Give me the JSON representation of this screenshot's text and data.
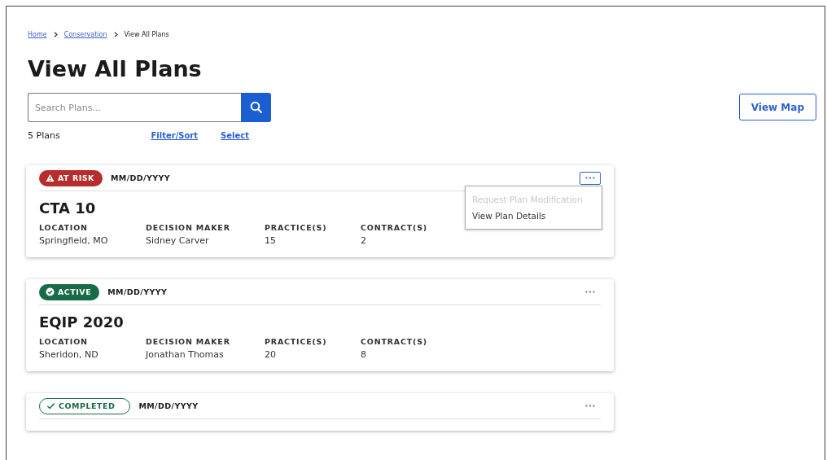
{
  "breadcrumb": [
    {
      "label": "Home",
      "kind": "link"
    },
    {
      "label": "Conservation",
      "kind": "link"
    },
    {
      "label": "View All Plans",
      "kind": "current"
    }
  ],
  "title": "View All Plans",
  "search": {
    "placeholder": "Search Plans..."
  },
  "view_map_button": "View Map",
  "count": "5 Plans",
  "actions": [
    "Filter/Sort",
    "Select"
  ],
  "plans": [
    {
      "status": {
        "kind": "at_risk",
        "label": "AT RISK"
      },
      "date": "MM/DD/YYYY",
      "name": "CTA 10",
      "menu_open": true,
      "menu": [
        {
          "label": "Request Plan Modification",
          "disabled": true
        },
        {
          "label": "View Plan Details",
          "disabled": false
        }
      ],
      "fields": [
        {
          "label": "LOCATION",
          "value": "Springfield, MO"
        },
        {
          "label": "DECISION MAKER",
          "value": "Sidney Carver"
        },
        {
          "label": "PRACTICE(S)",
          "value": "15"
        },
        {
          "label": "CONTRACT(S)",
          "value": "2"
        }
      ]
    },
    {
      "status": {
        "kind": "active",
        "label": "ACTIVE"
      },
      "date": "MM/DD/YYYY",
      "name": "EQIP 2020",
      "menu_open": false,
      "fields": [
        {
          "label": "LOCATION",
          "value": "Sheridon, ND"
        },
        {
          "label": "DECISION MAKER",
          "value": "Jonathan Thomas"
        },
        {
          "label": "PRACTICE(S)",
          "value": "20"
        },
        {
          "label": "CONTRACT(S)",
          "value": "8"
        }
      ]
    },
    {
      "status": {
        "kind": "completed",
        "label": "COMPLETED"
      },
      "date": "MM/DD/YYYY",
      "menu_open": false
    }
  ]
}
